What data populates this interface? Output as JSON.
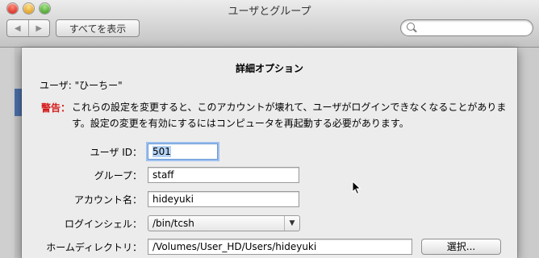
{
  "window": {
    "title": "ユーザとグループ"
  },
  "toolbar": {
    "back_glyph": "◀",
    "forward_glyph": "▶",
    "show_all_label": "すべてを表示",
    "search_placeholder": ""
  },
  "sheet": {
    "title": "詳細オプション",
    "user_line": "ユーザ: \"ひーちー\"",
    "warning_label": "警告：",
    "warning_text": "これらの設定を変更すると、このアカウントが壊れて、ユーザがログインできなくなることがあります。設定の変更を有効にするにはコンピュータを再起動する必要があります。",
    "fields": {
      "user_id": {
        "label": "ユーザ ID：",
        "value": "501"
      },
      "group": {
        "label": "グループ：",
        "value": "staff"
      },
      "account_name": {
        "label": "アカウント名：",
        "value": "hideyuki"
      },
      "login_shell": {
        "label": "ログインシェル：",
        "value": "/bin/tcsh",
        "arrow": "▼"
      },
      "home_directory": {
        "label": "ホームディレクトリ：",
        "value": "/Volumes/User_HD/Users/hideyuki"
      }
    },
    "choose_button_label": "選択..."
  },
  "colors": {
    "warning": "#d51a1a",
    "focus_ring": "#9cc0ef",
    "selection": "#b4d2f4"
  }
}
